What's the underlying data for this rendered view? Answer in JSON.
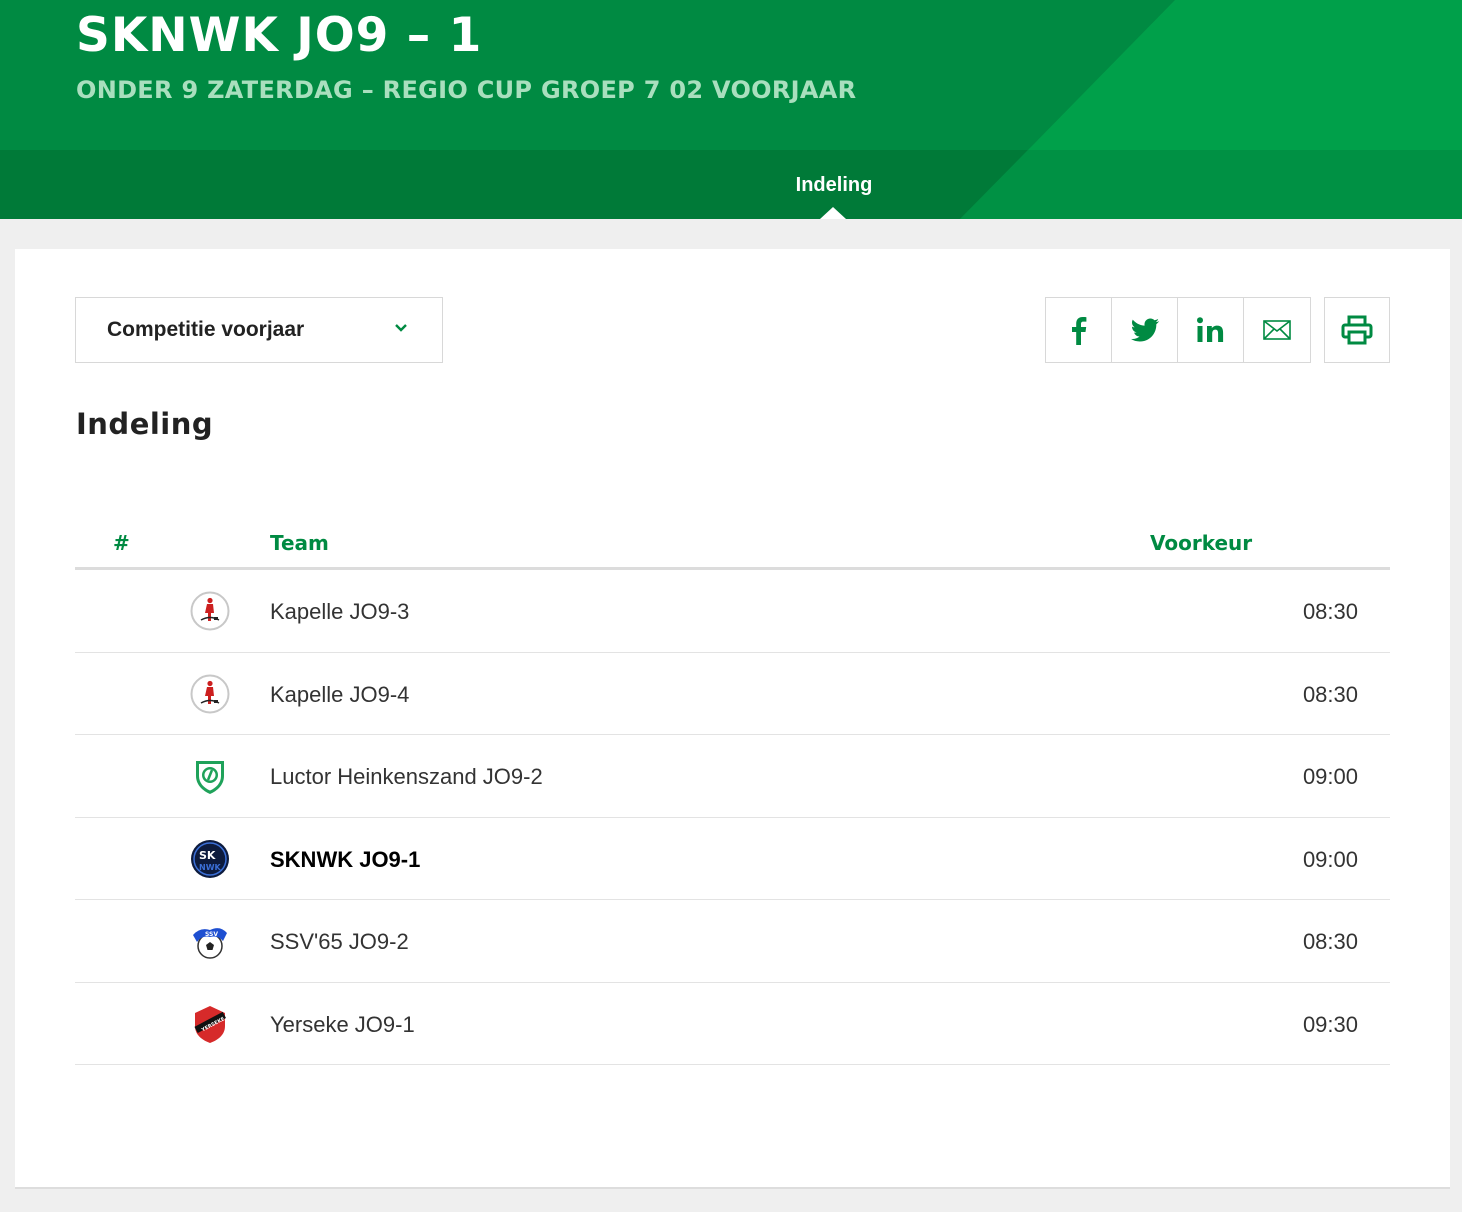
{
  "header": {
    "title": "SKNWK JO9 – 1",
    "subtitle": "ONDER 9 ZATERDAG – REGIO CUP GROEP 7 02 VOORJAAR",
    "nav_tab": "Indeling",
    "brand_color": "#008a42"
  },
  "filter": {
    "selected": "Competitie voorjaar"
  },
  "share": {
    "icons": [
      "facebook-icon",
      "twitter-icon",
      "linkedin-icon",
      "mail-icon"
    ],
    "print_icon": "printer-icon"
  },
  "section_title": "Indeling",
  "table": {
    "headers": {
      "num": "#",
      "team": "Team",
      "preference": "Voorkeur"
    },
    "rows": [
      {
        "team": "Kapelle JO9-3",
        "time": "08:30",
        "logo": "kapelle-logo"
      },
      {
        "team": "Kapelle JO9-4",
        "time": "08:30",
        "logo": "kapelle-logo"
      },
      {
        "team": "Luctor Heinkenszand JO9-2",
        "time": "09:00",
        "logo": "luctor-logo"
      },
      {
        "team": "SKNWK JO9-1",
        "time": "09:00",
        "logo": "sknwk-logo",
        "highlight": true
      },
      {
        "team": "SSV'65 JO9-2",
        "time": "08:30",
        "logo": "ssv65-logo"
      },
      {
        "team": "Yerseke JO9-1",
        "time": "09:30",
        "logo": "yerseke-logo"
      }
    ]
  }
}
